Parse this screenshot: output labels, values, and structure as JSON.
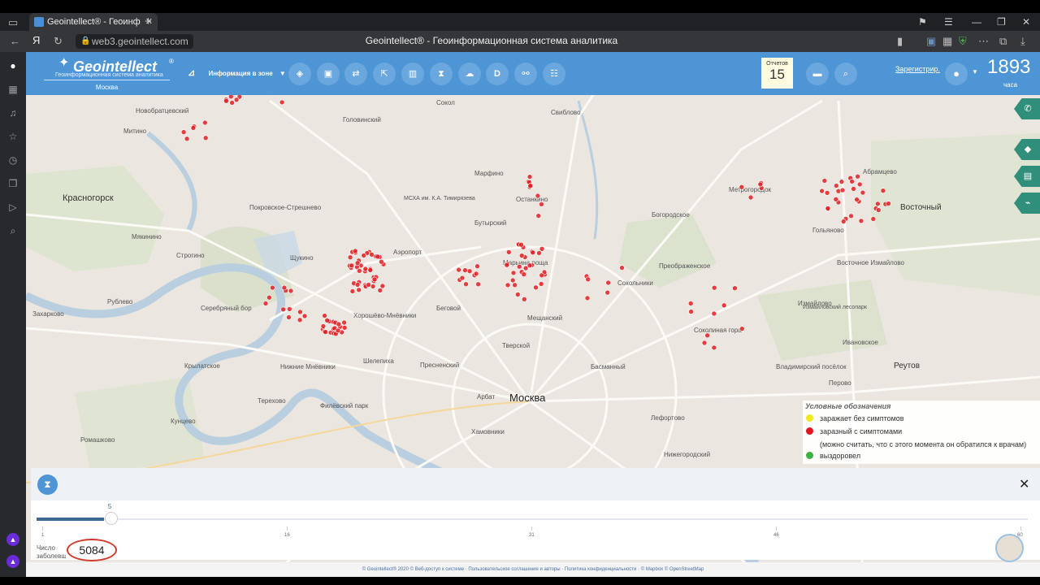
{
  "browser": {
    "tab_title": "Geointellect® - Геоинф",
    "url": "web3.geointellect.com",
    "page_title": "Geointellect® - Геоинформационная система аналитика"
  },
  "header": {
    "logo_name": "Geointellect",
    "logo_reg": "®",
    "logo_tagline": "Геоинформационная система аналитика",
    "logo_city": "Москва",
    "zone_label": "Информация в зоне",
    "reports_label": "Отчетов",
    "reports_count": "15",
    "register_link": "Зарегистрир.",
    "hours_value": "1893",
    "hours_label": "часа"
  },
  "toolbar_icons": [
    "layers-icon",
    "card-icon",
    "route-icon",
    "export-icon",
    "chart-icon",
    "hourglass-icon",
    "cloud-icon",
    "d-icon",
    "network-icon",
    "settings-icon"
  ],
  "map_labels": [
    "Новобратцевский",
    "Свиблово",
    "Митино",
    "Головинский",
    "Марфино",
    "Метрогородок",
    "Абрамцево",
    "Красногорск",
    "Покровское-Стрешнево",
    "МСХА им. К.А. Тимирязева",
    "Останкино",
    "Восточный",
    "Мякинино",
    "Бутырский",
    "Богородское",
    "Гольяново",
    "Сокольники",
    "Щукино",
    "Аэропорт",
    "Марьина роща",
    "Преображенское",
    "Восточное Измайлово",
    "Строгино",
    "Хорошёво-Мнёвники",
    "Беговой",
    "Мещанский",
    "Измайлово",
    "Измайловский лесопарк",
    "Крылатское",
    "Тверской",
    "Басманный",
    "Соколиная гора",
    "Ивановское",
    "Пресненский",
    "Реутов",
    "Москва",
    "Кунцево",
    "Лефортово",
    "Филёвский парк",
    "Терехово",
    "Нижние Мнёвники",
    "Шелепиха",
    "Хамовники",
    "Нижегородский",
    "Перово",
    "Ромашково",
    "Захарково",
    "Рублево",
    "Серебряный бор",
    "Владимирский посёлок",
    "Арбат",
    "Сокол",
    "Кузьминки",
    "Рублево",
    "Сетунь"
  ],
  "legend": {
    "title": "Условные обозначения",
    "items": [
      {
        "label": "заражает без симптомов",
        "color": "#f2ea1c"
      },
      {
        "label": "заразный с симптомами",
        "color": "#e3141e"
      },
      {
        "label": "выздоровел",
        "color": "#3cb043"
      }
    ],
    "note": "(можно считать, что с этого момента он обратился к врачам)"
  },
  "timeline": {
    "current_day": "5",
    "ticks": [
      "1",
      "16",
      "31",
      "46",
      "60"
    ],
    "cases_label": "Число заболевших",
    "cases_value": "5084"
  },
  "footer": "© Geointellect® 2020 © Веб-доступ к системе · Пользовательское соглашение и авторы · Политика конфиденциальности · © Mapbox © OpenStreetMap"
}
